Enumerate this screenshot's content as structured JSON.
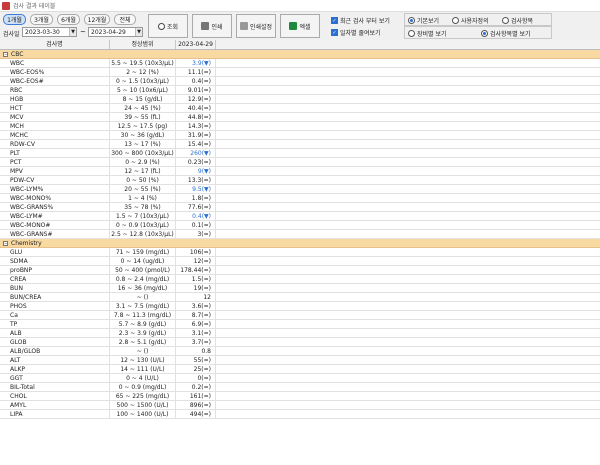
{
  "window": {
    "title": "검사 결과 테이블"
  },
  "toolbar": {
    "periods": [
      "1개월",
      "3개월",
      "6개월",
      "12개월",
      "전체"
    ],
    "date_label": "검사일",
    "date_from": "2023-03-30",
    "date_to": "2023-04-29",
    "tilde": "~",
    "search_label": "조회",
    "print_label": "인쇄",
    "print_setup_label": "인쇄설정",
    "excel_label": "엑셀",
    "check_recent": "최근 검사 부터 보기",
    "check_fold": "일자별 줄여보기",
    "radio_basic": "기본보기",
    "radio_user": "사용자정의",
    "radio_item": "검사항목",
    "radio_device": "장비별 보기",
    "radio_item_view": "검사항목별 보기"
  },
  "grid": {
    "headers": [
      "검사명",
      "정상범위",
      "2023-04-29"
    ],
    "groups": [
      {
        "name": "CBC",
        "rows": [
          [
            "WBC",
            "5.5 ~ 19.5 (10x3/μL)",
            "3.9(▼)",
            "low"
          ],
          [
            "WBC-EOS%",
            "2 ~ 12 (%)",
            "11.1(=)",
            ""
          ],
          [
            "WBC-EOS#",
            "0 ~ 1.5 (10x3/μL)",
            "0.4(=)",
            ""
          ],
          [
            "RBC",
            "5 ~ 10 (10x6/μL)",
            "9.01(=)",
            ""
          ],
          [
            "HGB",
            "8 ~ 15 (g/dL)",
            "12.9(=)",
            ""
          ],
          [
            "HCT",
            "24 ~ 45 (%)",
            "40.4(=)",
            ""
          ],
          [
            "MCV",
            "39 ~ 55 (fL)",
            "44.8(=)",
            ""
          ],
          [
            "MCH",
            "12.5 ~ 17.5 (pg)",
            "14.3(=)",
            ""
          ],
          [
            "MCHC",
            "30 ~ 36 (g/dL)",
            "31.9(=)",
            ""
          ],
          [
            "RDW-CV",
            "13 ~ 17 (%)",
            "15.4(=)",
            ""
          ],
          [
            "PLT",
            "300 ~ 800 (10x3/μL)",
            "260(▼)",
            "low"
          ],
          [
            "PCT",
            "0 ~ 2.9 (%)",
            "0.23(=)",
            ""
          ],
          [
            "MPV",
            "12 ~ 17 (fL)",
            "9(▼)",
            "low"
          ],
          [
            "PDW-CV",
            "0 ~ 50 (%)",
            "13.3(=)",
            ""
          ],
          [
            "WBC-LYM%",
            "20 ~ 55 (%)",
            "9.5(▼)",
            "low"
          ],
          [
            "WBC-MONO%",
            "1 ~ 4 (%)",
            "1.8(=)",
            ""
          ],
          [
            "WBC-GRANS%",
            "35 ~ 78 (%)",
            "77.6(=)",
            ""
          ],
          [
            "WBC-LYM#",
            "1.5 ~ 7 (10x3/μL)",
            "0.4(▼)",
            "low"
          ],
          [
            "WBC-MONO#",
            "0 ~ 0.9 (10x3/μL)",
            "0.1(=)",
            ""
          ],
          [
            "WBC-GRANS#",
            "2.5 ~ 12.8 (10x3/μL)",
            "3(=)",
            ""
          ]
        ]
      },
      {
        "name": "Chemistry",
        "rows": [
          [
            "GLU",
            "71 ~ 159 (mg/dL)",
            "106(=)",
            ""
          ],
          [
            "SDMA",
            "0 ~ 14 (ug/dL)",
            "12(=)",
            ""
          ],
          [
            "proBNP",
            "50 ~ 400 (pmol/L)",
            "178.44(=)",
            ""
          ],
          [
            "CREA",
            "0.8 ~ 2.4 (mg/dL)",
            "1.5(=)",
            ""
          ],
          [
            "BUN",
            "16 ~ 36 (mg/dL)",
            "19(=)",
            ""
          ],
          [
            "BUN/CREA",
            "~ ()",
            "12",
            ""
          ],
          [
            "PHOS",
            "3.1 ~ 7.5 (mg/dL)",
            "3.6(=)",
            ""
          ],
          [
            "Ca",
            "7.8 ~ 11.3 (mg/dL)",
            "8.7(=)",
            ""
          ],
          [
            "TP",
            "5.7 ~ 8.9 (g/dL)",
            "6.9(=)",
            ""
          ],
          [
            "ALB",
            "2.3 ~ 3.9 (g/dL)",
            "3.1(=)",
            ""
          ],
          [
            "GLOB",
            "2.8 ~ 5.1 (g/dL)",
            "3.7(=)",
            ""
          ],
          [
            "ALB/GLOB",
            "~ ()",
            "0.8",
            ""
          ],
          [
            "ALT",
            "12 ~ 130 (U/L)",
            "55(=)",
            ""
          ],
          [
            "ALKP",
            "14 ~ 111 (U/L)",
            "25(=)",
            ""
          ],
          [
            "GGT",
            "0 ~ 4 (U/L)",
            "0(=)",
            ""
          ],
          [
            "BIL-Total",
            "0 ~ 0.9 (mg/dL)",
            "0.2(=)",
            ""
          ],
          [
            "CHOL",
            "65 ~ 225 (mg/dL)",
            "161(=)",
            ""
          ],
          [
            "AMYL",
            "500 ~ 1500 (U/L)",
            "896(=)",
            ""
          ],
          [
            "LIPA",
            "100 ~ 1400 (U/L)",
            "494(=)",
            ""
          ]
        ]
      }
    ]
  }
}
